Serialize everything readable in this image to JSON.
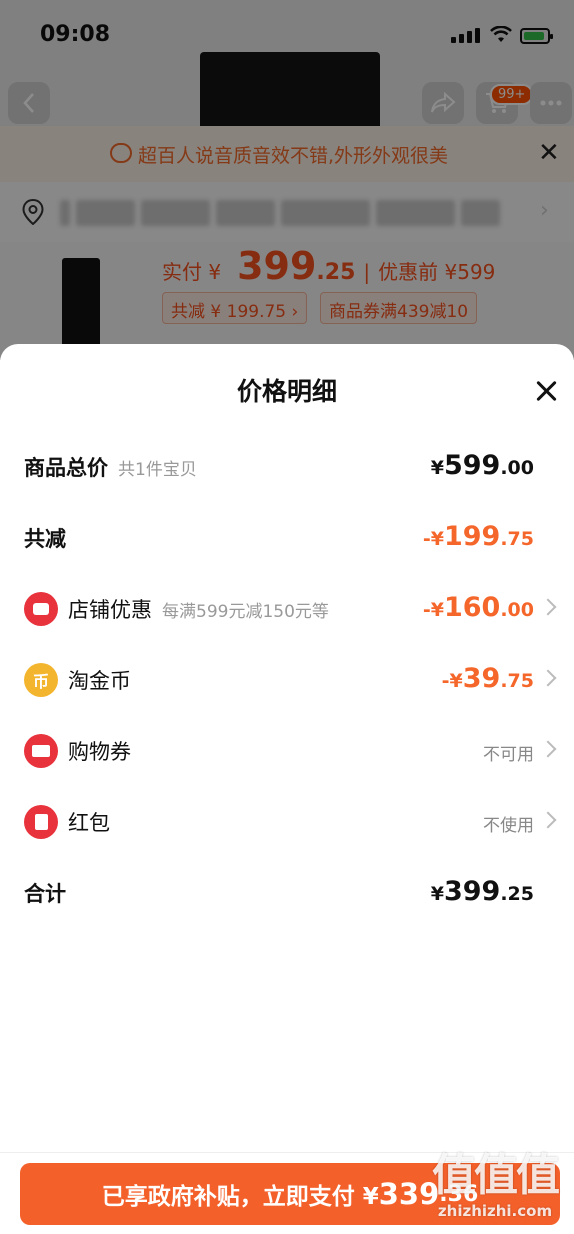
{
  "status_bar": {
    "time": "09:08"
  },
  "background": {
    "cart_badge": "99+",
    "notice": "超百人说音质音效不错,外形外观很美",
    "price": {
      "label": "实付 ¥",
      "integer": "399",
      "decimal": ".25",
      "separator": "|",
      "before_label": "优惠前 ¥599"
    },
    "tags": [
      "共减 ¥ 199.75 ›",
      "商品券满439减10"
    ]
  },
  "sheet": {
    "title": "价格明细",
    "rows": [
      {
        "label": "商品总价",
        "sub": "共1件宝贝",
        "currency": "¥",
        "integer": "599",
        "decimal": ".00",
        "color": "#111111"
      },
      {
        "label": "共减",
        "currency": "-¥",
        "integer": "199",
        "decimal": ".75",
        "color": "#f5662a"
      },
      {
        "label": "店铺优惠",
        "sub": "每满599元减150元等",
        "currency": "-¥",
        "integer": "160",
        "decimal": ".00",
        "color": "#f5662a",
        "icon": "store-icon"
      },
      {
        "label": "淘金币",
        "currency": "-¥",
        "integer": "39",
        "decimal": ".75",
        "color": "#f5662a",
        "icon": "coin-icon",
        "icon_glyph": "币"
      },
      {
        "label": "购物券",
        "status": "不可用",
        "icon": "ticket-icon"
      },
      {
        "label": "红包",
        "status": "不使用",
        "icon": "red-envelope-icon"
      },
      {
        "label": "合计",
        "currency": "¥",
        "integer": "399",
        "decimal": ".25",
        "color": "#111111"
      }
    ]
  },
  "pay_button": {
    "text": "已享政府补贴，立即支付 ¥",
    "integer": "339",
    "decimal": ".36"
  },
  "watermark": {
    "big": "值值值",
    "small": "zhizhizhi.com"
  },
  "colors": {
    "accent": "#f4602a",
    "discount": "#f5662a",
    "icon_red": "#e8323c",
    "icon_gold": "#f4b52e"
  }
}
